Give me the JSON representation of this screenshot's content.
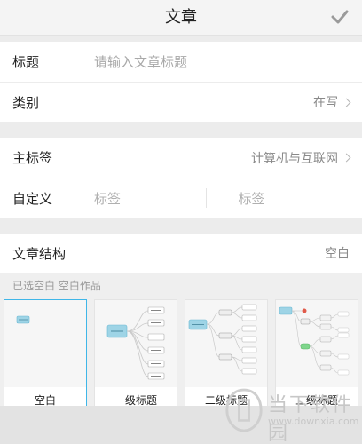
{
  "header": {
    "title": "文章",
    "confirm_icon": "check-icon"
  },
  "title_row": {
    "label": "标题",
    "placeholder": "请输入文章标题"
  },
  "category_row": {
    "label": "类别",
    "value": "在写"
  },
  "main_tag_row": {
    "label": "主标签",
    "value": "计算机与互联网"
  },
  "custom_row": {
    "label": "自定义",
    "tag1": "标签",
    "tag2": "标签"
  },
  "structure_row": {
    "label": "文章结构",
    "value": "空白"
  },
  "hint": "已选空白 空白作品",
  "templates": [
    {
      "name": "空白",
      "selected": true
    },
    {
      "name": "一级标题",
      "selected": false
    },
    {
      "name": "二级标题",
      "selected": false
    },
    {
      "name": "三级标题",
      "selected": false
    }
  ],
  "watermark": {
    "brand": "当下软件园",
    "url": "www.downxia.com"
  },
  "colors": {
    "accent": "#3fb6e8",
    "node": "#9ed4e6",
    "green_node": "#7fd68c",
    "red_node": "#e05a4a"
  }
}
